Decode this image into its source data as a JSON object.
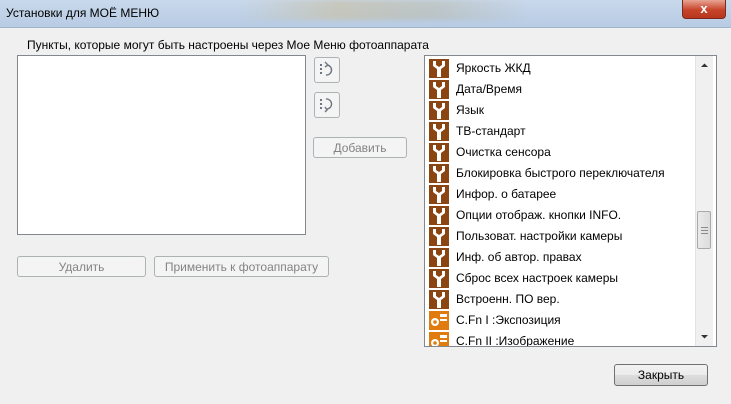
{
  "window": {
    "title": "Установки для МОЁ МЕНЮ",
    "close_glyph": "x"
  },
  "section": {
    "label": "Пункты, которые могут быть настроены через Мое Меню фотоаппарата"
  },
  "buttons": {
    "add": "Добавить",
    "delete": "Удалить",
    "apply": "Применить к фотоаппарату",
    "close": "Закрыть"
  },
  "icons": {
    "move_up": "sort-up-icon",
    "move_down": "sort-down-icon",
    "setup": "wrench-setup-icon",
    "custom": "custom-function-icon"
  },
  "colors": {
    "setup_icon": "#8b4513",
    "custom_icon": "#e07b10"
  },
  "available_items": [
    {
      "label": "Яркость ЖКД",
      "icon": "wrench-setup-icon"
    },
    {
      "label": "Дата/Время",
      "icon": "wrench-setup-icon"
    },
    {
      "label": "Язык",
      "icon": "wrench-setup-icon"
    },
    {
      "label": "ТВ-стандарт",
      "icon": "wrench-setup-icon"
    },
    {
      "label": "Очистка сенсора",
      "icon": "wrench-setup-icon"
    },
    {
      "label": "Блокировка быстрого переключателя",
      "icon": "wrench-setup-icon"
    },
    {
      "label": "Инфор. о батарее",
      "icon": "wrench-setup-icon"
    },
    {
      "label": "Опции отображ. кнопки INFO.",
      "icon": "wrench-setup-icon"
    },
    {
      "label": "Пользоват. настройки камеры",
      "icon": "wrench-setup-icon"
    },
    {
      "label": "Инф. об автор. правах",
      "icon": "wrench-setup-icon"
    },
    {
      "label": "Сброс всех настроек камеры",
      "icon": "wrench-setup-icon"
    },
    {
      "label": "Встроенн. ПО вер.",
      "icon": "wrench-setup-icon"
    },
    {
      "label": "C.Fn I :Экспозиция",
      "icon": "custom-function-icon"
    },
    {
      "label": "C.Fn II :Изображение",
      "icon": "custom-function-icon"
    }
  ]
}
